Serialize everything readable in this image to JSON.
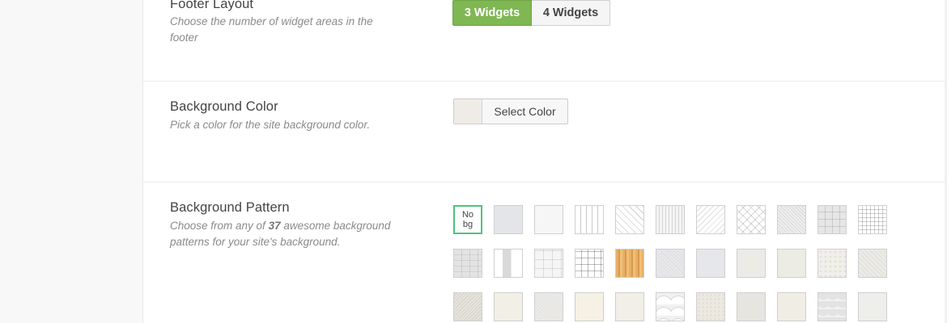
{
  "footer_layout": {
    "title": "Footer Layout",
    "description": "Choose the number of widget areas in the footer",
    "options": [
      "3 Widgets",
      "4 Widgets"
    ],
    "selected": "3 Widgets"
  },
  "background_color": {
    "title": "Background Color",
    "description": "Pick a color for the site background color.",
    "button_label": "Select Color",
    "current_color": "#efece8"
  },
  "background_pattern": {
    "title": "Background Pattern",
    "description_before": "Choose from any of ",
    "count": "37",
    "description_after": " awesome background patterns for your site's background.",
    "no_bg_label": "No bg",
    "selected": "No bg"
  },
  "colors": {
    "accent_green": "#7fb753",
    "selected_tile_border": "#4fc37c"
  }
}
